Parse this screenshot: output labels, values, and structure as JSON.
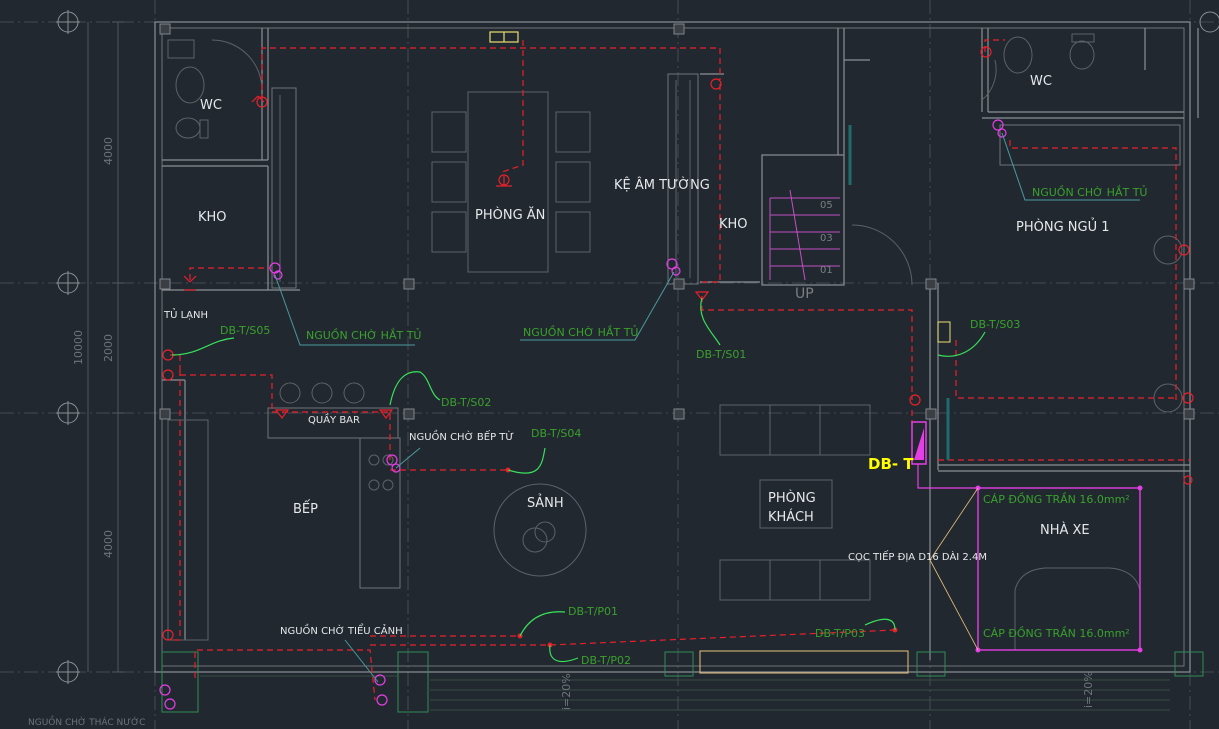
{
  "rooms": {
    "wc_left": "WC",
    "kho_left": "KHO",
    "phong_an": "PHÒNG ĂN",
    "ke_am_tuong": "KỆ ÂM TƯỜNG",
    "kho_mid": "KHO",
    "wc_right": "WC",
    "phong_ngu_1": "PHÒNG NGỦ 1",
    "tu_lanh": "TỦ LẠNH",
    "quay_bar": "QUẦY BAR",
    "bep": "BẾP",
    "sanh": "SẢNH",
    "phong_khach_1": "PHÒNG",
    "phong_khach_2": "KHÁCH",
    "nha_xe": "NHÀ XE"
  },
  "notes": {
    "nguon_cho_hat_tu": "NGUỒN CHỜ HẮT TỦ",
    "nguon_cho_bep_tu": "NGUỒN CHỜ BẾP TỪ",
    "nguon_cho_tieu_canh": "NGUỒN CHỜ TIỂU CẢNH",
    "nguon_cho_thac_nuoc": "NGUỒN CHỜ THÁC NƯỚC",
    "coc_tiep_dia": "CỌC TIẾP ĐỊA D16 DÀI 2.4M",
    "cap_dong_tran_1": "CÁP ĐỒNG TRẦN 16.0mm²",
    "cap_dong_tran_2": "CÁP ĐỒNG TRẦN 16.0mm²"
  },
  "circuits": {
    "s05": "DB-T/S05",
    "s02": "DB-T/S02",
    "s04": "DB-T/S04",
    "s01": "DB-T/S01",
    "s03": "DB-T/S03",
    "p01": "DB-T/P01",
    "p02": "DB-T/P02",
    "p03": "DB-T/P03"
  },
  "panel": "DB- T",
  "stairs": {
    "up": "UP",
    "step_05": "05",
    "step_03": "03",
    "step_01": "01"
  },
  "dimensions": {
    "d1": "4000",
    "d2": "2000",
    "d3": "4000",
    "total": "10000",
    "slope_left": "i=20%",
    "slope_right": "i=20%"
  },
  "colors": {
    "background": "#212830",
    "wire": "#e8202a",
    "circuit_label": "#3aa12c",
    "arrow": "#39e05a",
    "panel_label": "#ffff00",
    "ground": "#e53ee5"
  }
}
